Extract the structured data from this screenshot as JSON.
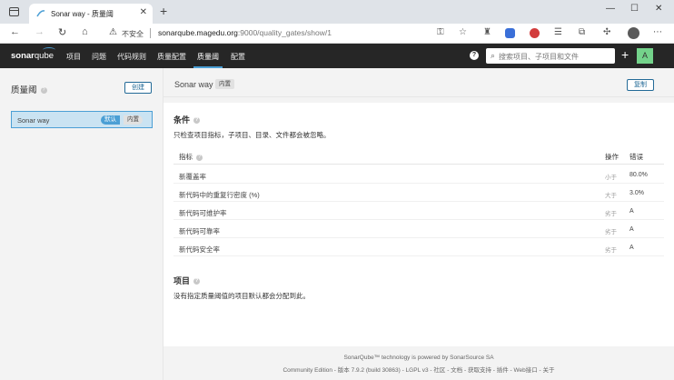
{
  "browser": {
    "tab_title": "Sonar way - 质量阈",
    "insecure_label": "不安全",
    "url_host": "sonarqube.magedu.org",
    "url_path": ":9000/quality_gates/show/1"
  },
  "nav": {
    "logo_bold": "sonar",
    "logo_light": "qube",
    "items": [
      "项目",
      "问题",
      "代码规则",
      "质量配置",
      "质量阈",
      "配置"
    ],
    "active_item": "质量阈",
    "search_placeholder": "搜索项目、子项目和文件",
    "avatar_letter": "A"
  },
  "left": {
    "title": "质量阈",
    "create_button": "创建",
    "gate": {
      "name": "Sonar way",
      "default_badge": "默认",
      "builtin_badge": "内置"
    }
  },
  "main": {
    "title": "Sonar way",
    "builtin_tag": "内置",
    "copy_button": "复制",
    "conditions": {
      "title": "条件",
      "description": "只检查项目指标，子项目、目录、文件都会被忽略。",
      "headers": {
        "metric": "指标",
        "operator": "操作",
        "error": "错误"
      },
      "rows": [
        {
          "metric": "新覆盖率",
          "operator": "小于",
          "error": "80.0%"
        },
        {
          "metric": "新代码中的重复行密度 (%)",
          "operator": "大于",
          "error": "3.0%"
        },
        {
          "metric": "新代码可维护率",
          "operator": "劣于",
          "error": "A"
        },
        {
          "metric": "新代码可靠率",
          "operator": "劣于",
          "error": "A"
        },
        {
          "metric": "新代码安全率",
          "operator": "劣于",
          "error": "A"
        }
      ]
    },
    "projects": {
      "title": "项目",
      "description": "没有指定质量阈值的项目默认都会分配到此。"
    }
  },
  "footer": {
    "line1": "SonarQube™ technology is powered by SonarSource SA",
    "line2": "Community Edition - 版本 7.9.2 (build 30863) - LGPL v3 - 社区 - 文档 - 获取支持 - 插件 - Web接口 - 关于"
  }
}
